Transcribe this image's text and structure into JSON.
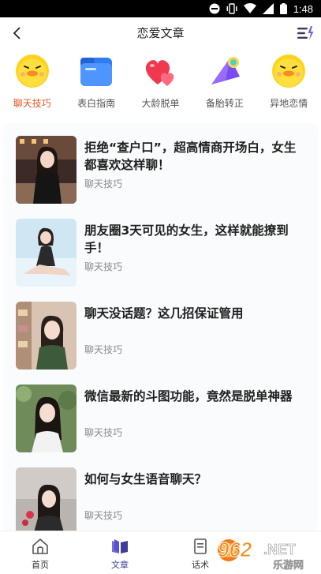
{
  "status": {
    "time": "1:48"
  },
  "nav": {
    "title": "恋爱文章"
  },
  "categories": [
    {
      "label": "聊天技巧",
      "active": true,
      "icon": "duck-icon"
    },
    {
      "label": "表白指南",
      "active": false,
      "icon": "folder-icon"
    },
    {
      "label": "大龄脱单",
      "active": false,
      "icon": "hearts-icon"
    },
    {
      "label": "备胎转正",
      "active": false,
      "icon": "megaphone-icon"
    },
    {
      "label": "异地恋情",
      "active": false,
      "icon": "duck-icon"
    }
  ],
  "articles": [
    {
      "title": "拒绝“查户口”，超高情商开场白，女生都喜欢这样聊！",
      "tag": "聊天技巧"
    },
    {
      "title": "朋友圈3天可见的女生，这样就能撩到手！",
      "tag": "聊天技巧"
    },
    {
      "title": "聊天没话题？这几招保证管用",
      "tag": "聊天技巧"
    },
    {
      "title": "微信最新的斗图功能，竟然是脱单神器",
      "tag": "聊天技巧"
    },
    {
      "title": "如何与女生语音聊天？",
      "tag": "聊天技巧"
    }
  ],
  "tabs": [
    {
      "label": "首页",
      "icon": "home-icon",
      "active": false
    },
    {
      "label": "文章",
      "icon": "book-icon",
      "active": true
    },
    {
      "label": "话术",
      "icon": "document-icon",
      "active": false
    }
  ],
  "watermark": {
    "brand": "962.NET",
    "sub": "乐游网"
  },
  "colors": {
    "accent": "#e6551f",
    "tab_active": "#3f3f9a",
    "list_bg": "#f9fbfd"
  }
}
